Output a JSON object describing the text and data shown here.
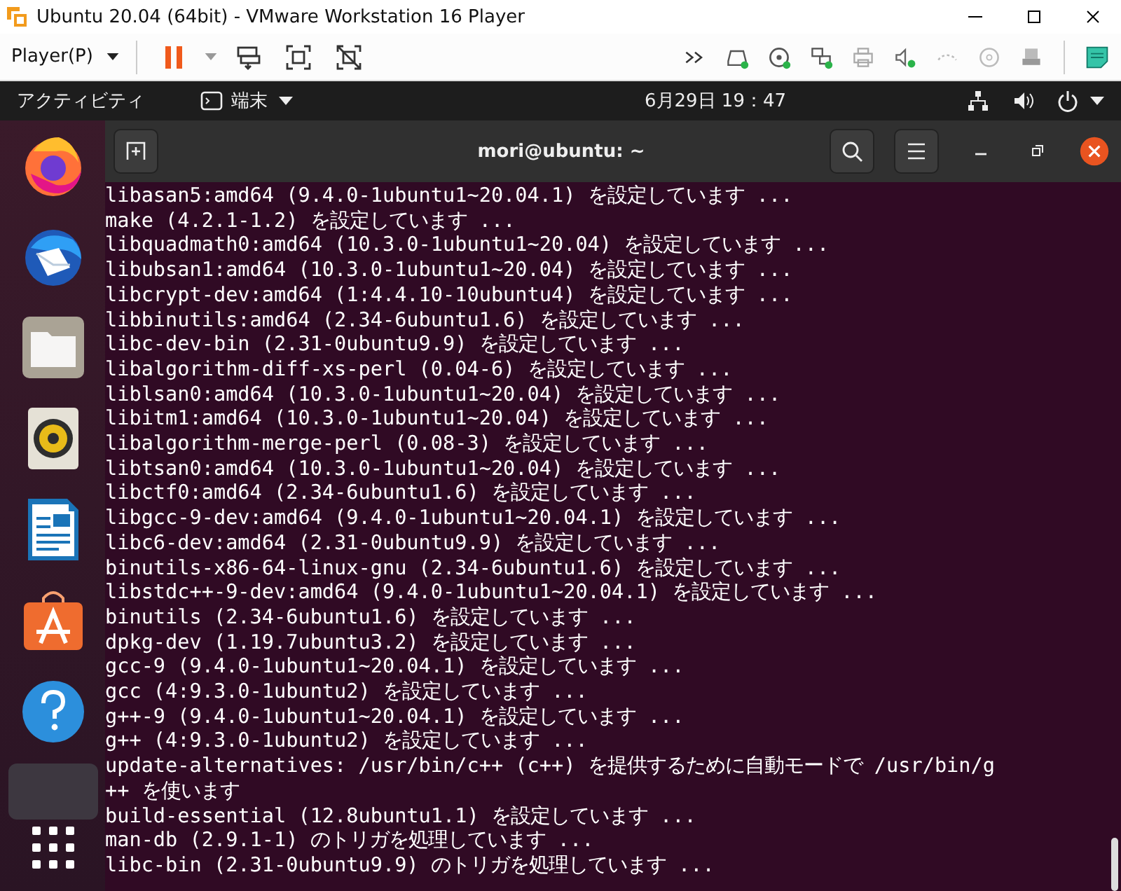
{
  "window": {
    "title": "Ubuntu 20.04 (64bit) - VMware Workstation 16 Player"
  },
  "toolbar": {
    "menu": "Player(P)"
  },
  "topbar": {
    "activities": "アクティビティ",
    "app": "端末",
    "clock": "6月29日  19：47"
  },
  "terminal": {
    "title": "mori@ubuntu: ~",
    "lines": [
      "libasan5:amd64 (9.4.0-1ubuntu1~20.04.1) を設定しています ...",
      "make (4.2.1-1.2) を設定しています ...",
      "libquadmath0:amd64 (10.3.0-1ubuntu1~20.04) を設定しています ...",
      "libubsan1:amd64 (10.3.0-1ubuntu1~20.04) を設定しています ...",
      "libcrypt-dev:amd64 (1:4.4.10-10ubuntu4) を設定しています ...",
      "libbinutils:amd64 (2.34-6ubuntu1.6) を設定しています ...",
      "libc-dev-bin (2.31-0ubuntu9.9) を設定しています ...",
      "libalgorithm-diff-xs-perl (0.04-6) を設定しています ...",
      "liblsan0:amd64 (10.3.0-1ubuntu1~20.04) を設定しています ...",
      "libitm1:amd64 (10.3.0-1ubuntu1~20.04) を設定しています ...",
      "libalgorithm-merge-perl (0.08-3) を設定しています ...",
      "libtsan0:amd64 (10.3.0-1ubuntu1~20.04) を設定しています ...",
      "libctf0:amd64 (2.34-6ubuntu1.6) を設定しています ...",
      "libgcc-9-dev:amd64 (9.4.0-1ubuntu1~20.04.1) を設定しています ...",
      "libc6-dev:amd64 (2.31-0ubuntu9.9) を設定しています ...",
      "binutils-x86-64-linux-gnu (2.34-6ubuntu1.6) を設定しています ...",
      "libstdc++-9-dev:amd64 (9.4.0-1ubuntu1~20.04.1) を設定しています ...",
      "binutils (2.34-6ubuntu1.6) を設定しています ...",
      "dpkg-dev (1.19.7ubuntu3.2) を設定しています ...",
      "gcc-9 (9.4.0-1ubuntu1~20.04.1) を設定しています ...",
      "gcc (4:9.3.0-1ubuntu2) を設定しています ...",
      "g++-9 (9.4.0-1ubuntu1~20.04.1) を設定しています ...",
      "g++ (4:9.3.0-1ubuntu2) を設定しています ...",
      "update-alternatives: /usr/bin/c++ (c++) を提供するために自動モードで /usr/bin/g",
      "++ を使います",
      "build-essential (12.8ubuntu1.1) を設定しています ...",
      "man-db (2.9.1-1) のトリガを処理しています ...",
      "libc-bin (2.31-0ubuntu9.9) のトリガを処理しています ..."
    ]
  }
}
